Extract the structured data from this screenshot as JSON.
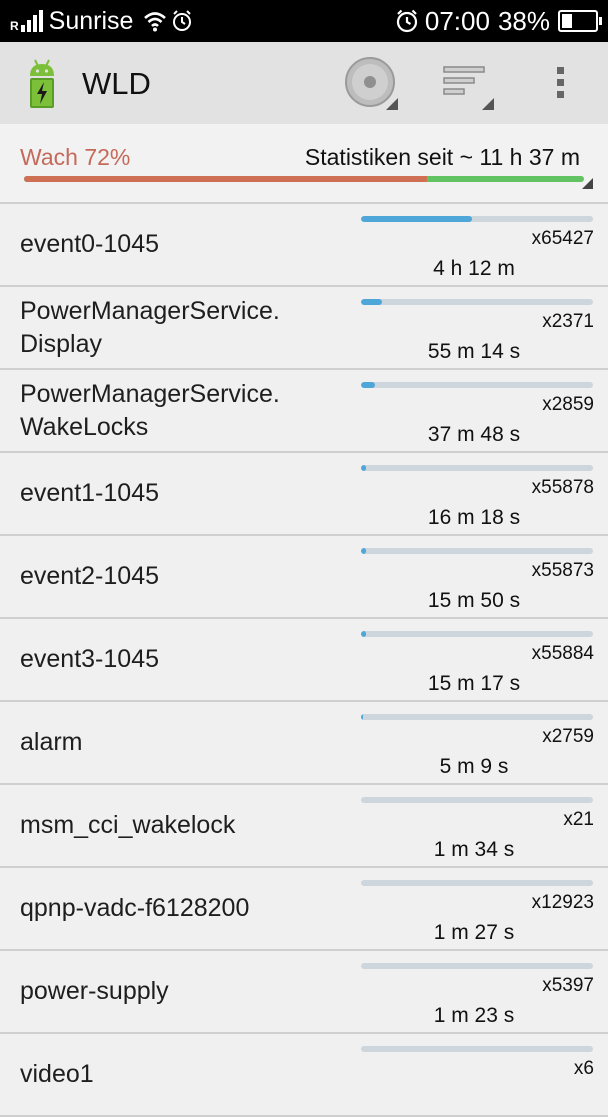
{
  "status_bar": {
    "signal_prefix": "R",
    "carrier": "Sunrise",
    "time": "07:00",
    "battery_percent": "38%",
    "battery_level": 0.38,
    "icons": [
      "signal-icon",
      "wifi-icon",
      "alarm-icon",
      "alarm-clock-icon",
      "battery-icon"
    ]
  },
  "action_bar": {
    "title": "WLD",
    "icons": [
      "android-battery-app-icon",
      "disc-icon",
      "sort-icon",
      "overflow-menu-icon"
    ]
  },
  "summary": {
    "awake_label": "Wach 72%",
    "awake_fraction": 0.72,
    "stats_since": "Statistiken seit ~ 11 h 37 m"
  },
  "colors": {
    "awake": "#cf6f54",
    "asleep": "#62c362",
    "progress": "#4fa6d9",
    "track": "#cdd6dc"
  },
  "wakelocks": [
    {
      "name": "event0-1045",
      "count": "x65427",
      "duration": "4 h 12 m",
      "fraction": 0.48
    },
    {
      "name": "PowerManagerService.\nDisplay",
      "count": "x2371",
      "duration": "55 m 14 s",
      "fraction": 0.09
    },
    {
      "name": "PowerManagerService.\nWakeLocks",
      "count": "x2859",
      "duration": "37 m 48 s",
      "fraction": 0.06
    },
    {
      "name": "event1-1045",
      "count": "x55878",
      "duration": "16 m 18 s",
      "fraction": 0.02
    },
    {
      "name": "event2-1045",
      "count": "x55873",
      "duration": "15 m 50 s",
      "fraction": 0.02
    },
    {
      "name": "event3-1045",
      "count": "x55884",
      "duration": "15 m 17 s",
      "fraction": 0.02
    },
    {
      "name": "alarm",
      "count": "x2759",
      "duration": "5 m 9 s",
      "fraction": 0.006
    },
    {
      "name": "msm_cci_wakelock",
      "count": "x21",
      "duration": "1 m 34 s",
      "fraction": 0
    },
    {
      "name": "qpnp-vadc-f6128200",
      "count": "x12923",
      "duration": "1 m 27 s",
      "fraction": 0
    },
    {
      "name": "power-supply",
      "count": "x5397",
      "duration": "1 m 23 s",
      "fraction": 0
    },
    {
      "name": "video1",
      "count": "x6",
      "duration": "",
      "fraction": 0
    }
  ]
}
